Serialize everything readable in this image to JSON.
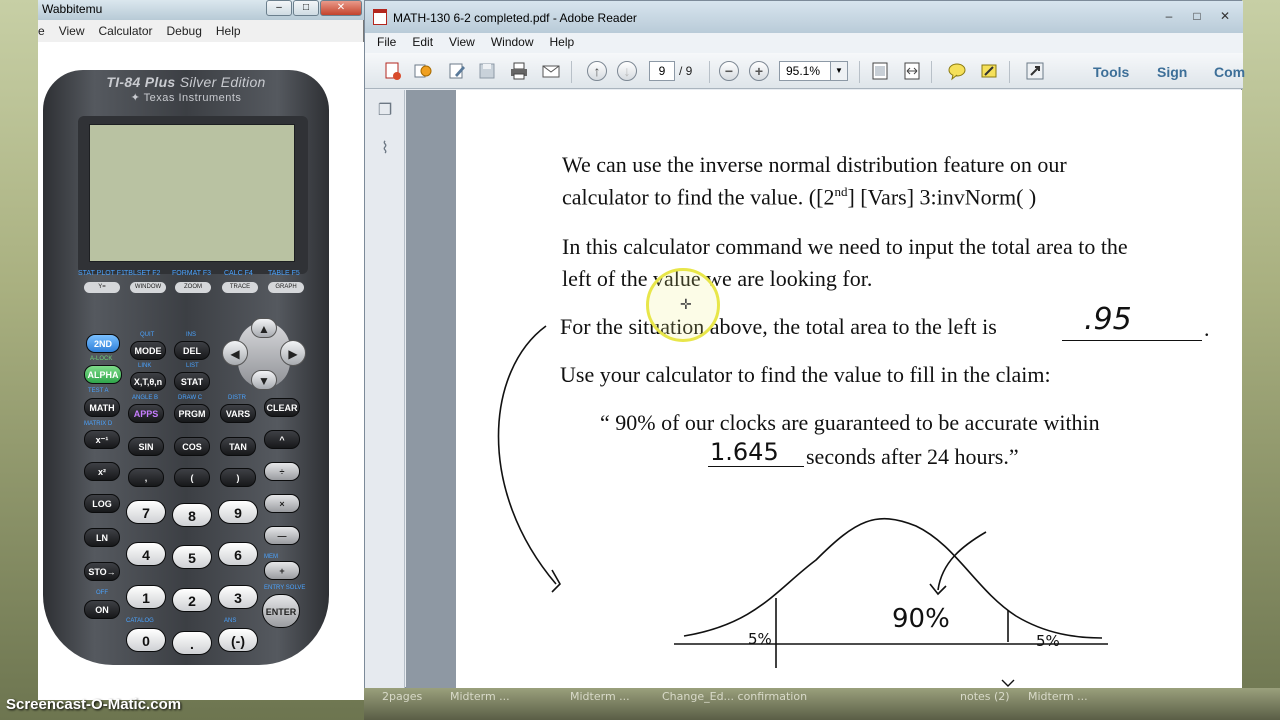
{
  "wabbitemu": {
    "title": "Wabbitemu",
    "menu": [
      "e",
      "View",
      "Calculator",
      "Debug",
      "Help"
    ]
  },
  "calculator": {
    "model": "TI-84 Plus",
    "edition": "Silver Edition",
    "brand": "Texas Instruments",
    "fkeys": [
      {
        "label": "Y=",
        "above": "STAT PLOT F1"
      },
      {
        "label": "WINDOW",
        "above": "TBLSET F2"
      },
      {
        "label": "ZOOM",
        "above": "FORMAT F3"
      },
      {
        "label": "TRACE",
        "above": "CALC F4"
      },
      {
        "label": "GRAPH",
        "above": "TABLE F5"
      }
    ],
    "keys": {
      "second": "2ND",
      "mode": "MODE",
      "del": "DEL",
      "alpha": "ALPHA",
      "xt": "X,T,θ,n",
      "stat": "STAT",
      "math": "MATH",
      "apps": "APPS",
      "prgm": "PRGM",
      "vars": "VARS",
      "clear": "CLEAR",
      "inv": "x⁻¹",
      "sin": "SIN",
      "cos": "COS",
      "tan": "TAN",
      "pow": "^",
      "sq": "x²",
      "comma": ",",
      "lparen": "(",
      "rparen": ")",
      "div": "÷",
      "log": "LOG",
      "n7": "7",
      "n8": "8",
      "n9": "9",
      "mul": "×",
      "ln": "LN",
      "n4": "4",
      "n5": "5",
      "n6": "6",
      "sub": "—",
      "sto": "STO→",
      "n1": "1",
      "n2": "2",
      "n3": "3",
      "add": "+",
      "on": "ON",
      "n0": "0",
      "dot": ".",
      "neg": "(-)",
      "enter": "ENTER"
    },
    "labels": {
      "quit": "QUIT",
      "ins": "INS",
      "alock": "A-LOCK",
      "link": "LINK",
      "list": "LIST",
      "test": "TEST A",
      "angle": "ANGLE B",
      "draw": "DRAW C",
      "distr": "DISTR",
      "matrix": "MATRIX D",
      "mem": "MEM",
      "entry_solve": "ENTRY SOLVE",
      "off": "OFF",
      "catalog": "CATALOG",
      "ans": "ANS"
    }
  },
  "reader": {
    "title": "MATH-130 6-2 completed.pdf - Adobe Reader",
    "menu": [
      "File",
      "Edit",
      "View",
      "Window",
      "Help"
    ],
    "page_current": "9",
    "page_total": "/ 9",
    "zoom": "95.1%",
    "links": {
      "tools": "Tools",
      "sign": "Sign",
      "comment": "Com"
    }
  },
  "document": {
    "p1_line1": "We can use the inverse normal distribution feature on our",
    "p1_line2a": "calculator to find the value. ([2",
    "p1_sup": "nd",
    "p1_line2b": "] [Vars] 3:invNorm( )",
    "p2_line1": "In this calculator command we need to input the total area to the",
    "p2_line2": "left of the value we are looking for.",
    "p3_line": "For the situation above, the total area to the left is",
    "p3_answer": ".95",
    "p3_end": ".",
    "p4_line": "Use your calculator to find the value to fill in the claim:",
    "quote_line1": "“ 90% of our clocks are guaranteed to be accurate within",
    "quote_answer": "1.645",
    "quote_line2": "seconds after 24 hours.”",
    "curve_center": "90%",
    "curve_left": "5%",
    "curve_right": "5%"
  },
  "taskbar": [
    "2pages",
    "Midterm ...",
    "Midterm ...",
    "Change_Ed... confirmation",
    "notes (2)",
    "Midterm ..."
  ],
  "watermark": "Screencast-O-Matic.com"
}
